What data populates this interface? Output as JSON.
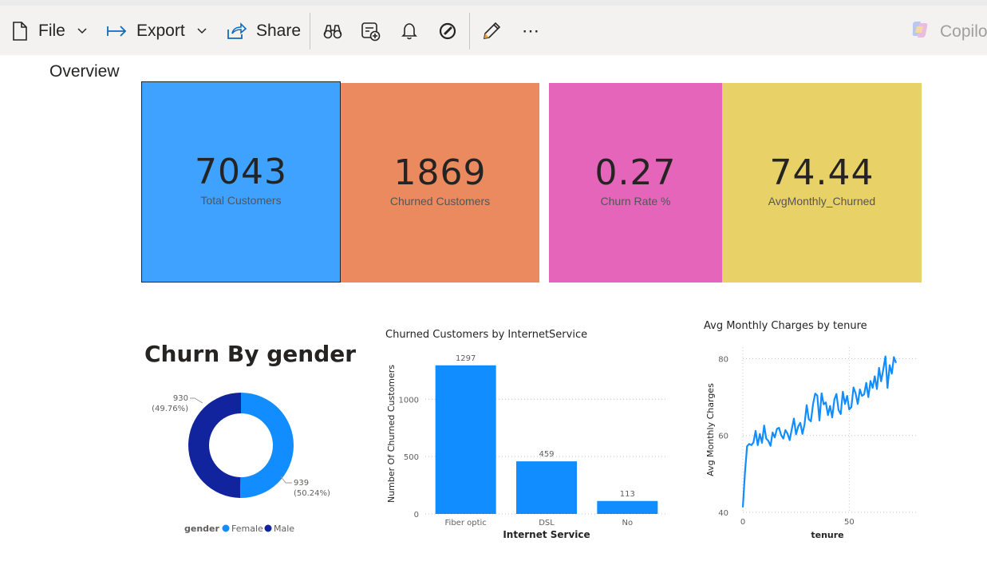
{
  "toolbar": {
    "file_label": "File",
    "export_label": "Export",
    "share_label": "Share",
    "copilot_label": "Copilo",
    "more_label": "⋯"
  },
  "page": {
    "title": "Overview"
  },
  "cards": [
    {
      "value": "7043",
      "label": "Total Customers",
      "color": "#3fa2ff"
    },
    {
      "value": "1869",
      "label": "Churned Customers",
      "color": "#eb895f"
    },
    {
      "value": "0.27",
      "label": "Churn Rate %",
      "color": "#e465b9"
    },
    {
      "value": "74.44",
      "label": "AvgMonthly_Churned",
      "color": "#e8d166"
    }
  ],
  "chart_data": [
    {
      "type": "donut",
      "title": "Churn By gender",
      "legend_title": "gender",
      "categories": [
        "Female",
        "Male"
      ],
      "values": [
        939,
        930
      ],
      "labels": [
        "939",
        "930"
      ],
      "percent_labels": [
        "(50.24%)",
        "(49.76%)"
      ],
      "colors": [
        "#118dff",
        "#12239e"
      ]
    },
    {
      "type": "bar",
      "title": "Churned Customers by InternetService",
      "xlabel": "Internet Service",
      "ylabel": "Number Of Churned Customers",
      "categories": [
        "Fiber optic",
        "DSL",
        "No"
      ],
      "values": [
        1297,
        459,
        113
      ],
      "ylim": [
        0,
        1400
      ],
      "yticks": [
        0,
        500,
        1000
      ],
      "color": "#118dff"
    },
    {
      "type": "line",
      "title": "Avg Monthly Charges by tenure",
      "xlabel": "tenure",
      "ylabel": "Avg Monthly Charges",
      "xlim": [
        0,
        72
      ],
      "ylim": [
        40,
        83
      ],
      "xticks": [
        0,
        50
      ],
      "yticks": [
        40,
        60,
        80
      ],
      "color": "#118dff",
      "x": [
        0,
        1,
        2,
        3,
        4,
        5,
        6,
        7,
        8,
        9,
        10,
        11,
        12,
        13,
        14,
        15,
        16,
        17,
        18,
        19,
        20,
        21,
        22,
        23,
        24,
        25,
        26,
        27,
        28,
        29,
        30,
        31,
        32,
        33,
        34,
        35,
        36,
        37,
        38,
        39,
        40,
        41,
        42,
        43,
        44,
        45,
        46,
        47,
        48,
        49,
        50,
        51,
        52,
        53,
        54,
        55,
        56,
        57,
        58,
        59,
        60,
        61,
        62,
        63,
        64,
        65,
        66,
        67,
        68,
        69,
        70,
        71,
        72
      ],
      "y": [
        41.3,
        50.5,
        57.2,
        57.8,
        57.5,
        58.2,
        61.2,
        57.5,
        60.4,
        58.1,
        62.6,
        59.2,
        58.6,
        57.3,
        60.8,
        59.5,
        61.7,
        62.0,
        60.1,
        59.2,
        61.4,
        60.5,
        58.8,
        61.6,
        64.4,
        60.3,
        62.3,
        63.3,
        60.4,
        62.9,
        67.9,
        64.2,
        63.7,
        68.2,
        70.9,
        70.4,
        63.9,
        71.0,
        68.1,
        68.6,
        65.3,
        67.7,
        64.7,
        69.4,
        70.8,
        66.6,
        65.6,
        71.4,
        68.2,
        70.3,
        66.8,
        67.4,
        72.5,
        71.0,
        68.2,
        72.0,
        70.3,
        70.7,
        73.7,
        70.0,
        74.2,
        72.4,
        75.4,
        72.1,
        77.6,
        74.1,
        77.2,
        80.6,
        72.4,
        78.3,
        76.1,
        80.4,
        78.9
      ]
    }
  ]
}
